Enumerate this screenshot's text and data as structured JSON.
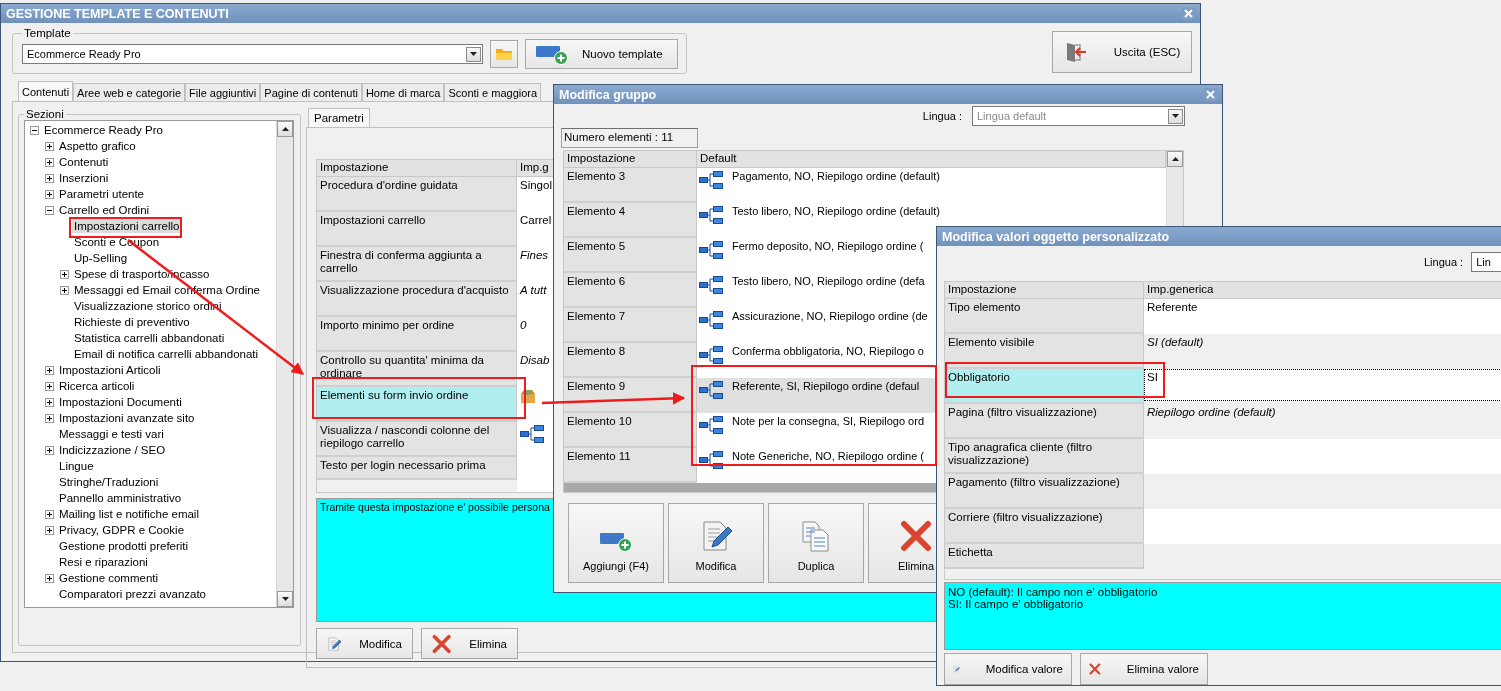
{
  "main_window": {
    "title": "GESTIONE TEMPLATE E CONTENUTI",
    "template": {
      "label": "Template",
      "value": "Ecommerce Ready Pro"
    },
    "template_buttons": [
      {
        "kind": "folder"
      },
      {
        "kind": "add",
        "label": "Nuovo template"
      }
    ],
    "exit_button": {
      "kind": "exit",
      "label": "Uscita (ESC)"
    },
    "tabs": [
      {
        "label": "Contenuti",
        "selected": true
      },
      {
        "label": "Aree web e categorie",
        "selected": false
      },
      {
        "label": "File aggiuntivi",
        "selected": false
      },
      {
        "label": "Pagine di contenuti",
        "selected": false
      },
      {
        "label": "Home di marca",
        "selected": false
      },
      {
        "label": "Sconti e maggiora",
        "selected": false
      }
    ],
    "sections": {
      "label": "Sezioni",
      "tree": {
        "label": "Ecommerce Ready Pro",
        "kind": "group",
        "expanded": true,
        "selected": false,
        "children": [
          {
            "label": "Aspetto grafico",
            "kind": "group",
            "expanded": false,
            "selected": false
          },
          {
            "label": "Contenuti",
            "kind": "group",
            "expanded": false,
            "selected": false
          },
          {
            "label": "Inserzioni",
            "kind": "group",
            "expanded": false,
            "selected": false
          },
          {
            "label": "Parametri utente",
            "kind": "group",
            "expanded": false,
            "selected": false
          },
          {
            "label": "Carrello ed Ordini",
            "kind": "group",
            "expanded": true,
            "selected": false,
            "children": [
              {
                "label": "Impostazioni carrello",
                "kind": "leaf",
                "selected": true
              },
              {
                "label": "Sconti e Coupon",
                "kind": "leaf",
                "selected": false
              },
              {
                "label": "Up-Selling",
                "kind": "leaf",
                "selected": false
              },
              {
                "label": "Spese di trasporto/incasso",
                "kind": "group",
                "expanded": false,
                "selected": false
              },
              {
                "label": "Messaggi ed Email conferma Ordine",
                "kind": "group",
                "expanded": false,
                "selected": false
              },
              {
                "label": "Visualizzazione storico ordini",
                "kind": "leaf",
                "selected": false
              },
              {
                "label": "Richieste di preventivo",
                "kind": "leaf",
                "selected": false
              },
              {
                "label": "Statistica carrelli abbandonati",
                "kind": "leaf",
                "selected": false
              },
              {
                "label": "Email di notifica carrelli abbandonati",
                "kind": "leaf",
                "selected": false
              }
            ]
          },
          {
            "label": "Impostazioni Articoli",
            "kind": "group",
            "expanded": false,
            "selected": false
          },
          {
            "label": "Ricerca articoli",
            "kind": "group",
            "expanded": false,
            "selected": false
          },
          {
            "label": "Impostazioni Documenti",
            "kind": "group",
            "expanded": false,
            "selected": false
          },
          {
            "label": "Impostazioni avanzate sito",
            "kind": "group",
            "expanded": false,
            "selected": false
          },
          {
            "label": "Messaggi e testi vari",
            "kind": "leaf",
            "selected": false
          },
          {
            "label": "Indicizzazione / SEO",
            "kind": "group",
            "expanded": false,
            "selected": false
          },
          {
            "label": "Lingue",
            "kind": "leaf",
            "selected": false
          },
          {
            "label": "Stringhe/Traduzioni",
            "kind": "leaf",
            "selected": false
          },
          {
            "label": "Pannello amministrativo",
            "kind": "leaf",
            "selected": false
          },
          {
            "label": "Mailing list e notifiche email",
            "kind": "group",
            "expanded": false,
            "selected": false
          },
          {
            "label": "Privacy, GDPR e Cookie",
            "kind": "group",
            "expanded": false,
            "selected": false
          },
          {
            "label": "Gestione prodotti preferiti",
            "kind": "leaf",
            "selected": false
          },
          {
            "label": "Resi e riparazioni",
            "kind": "leaf",
            "selected": false
          },
          {
            "label": "Gestione commenti",
            "kind": "group",
            "expanded": false,
            "selected": false
          },
          {
            "label": "Comparatori prezzi avanzato",
            "kind": "leaf",
            "selected": false
          }
        ]
      }
    },
    "parameters": {
      "tab": "Parametri",
      "columns": [
        "Impostazione",
        "Imp.g"
      ],
      "rows": [
        {
          "setting": "Procedura d'ordine guidata",
          "kind": "text",
          "value": "Singol",
          "selected": false
        },
        {
          "setting": "Impostazioni carrello",
          "kind": "text",
          "value": "Carrel",
          "selected": false
        },
        {
          "setting": "Finestra di conferma aggiunta a carrello",
          "kind": "default",
          "value": "Fines",
          "selected": false
        },
        {
          "setting": "Visualizzazione procedura d'acquisto",
          "kind": "default",
          "value": "A tutt",
          "selected": false
        },
        {
          "setting": "Importo minimo per ordine",
          "kind": "default",
          "value": "0",
          "selected": false
        },
        {
          "setting": "Controllo su quantita' minima da ordinare",
          "kind": "default",
          "value": "Disab",
          "selected": false
        },
        {
          "setting": "Elementi su form invio ordine",
          "kind": "package",
          "selected": true
        },
        {
          "setting": "Visualizza / nascondi colonne del riepilogo carrello",
          "kind": "hierarchy",
          "selected": false
        },
        {
          "setting": "Testo per login necessario prima",
          "kind": "empty",
          "selected": false
        }
      ],
      "description": "Tramite questa impostazione e' possibile persona",
      "buttons": [
        {
          "kind": "edit",
          "label": "Modifica"
        },
        {
          "kind": "delete",
          "label": "Elimina"
        }
      ]
    }
  },
  "group_dialog": {
    "title": "Modifica gruppo",
    "language_label": "Lingua :",
    "language": {
      "value": "Lingua default",
      "disabled": true
    },
    "count": "Numero elementi : 11",
    "columns": [
      "Impostazione",
      "Default"
    ],
    "rows": [
      {
        "name": "Elemento 3",
        "value": "Pagamento, NO, Riepilogo ordine (default)",
        "selected": false
      },
      {
        "name": "Elemento 4",
        "value": "Testo libero, NO, Riepilogo ordine (default)",
        "selected": false
      },
      {
        "name": "Elemento 5",
        "value": "Fermo deposito, NO, Riepilogo ordine (",
        "selected": false
      },
      {
        "name": "Elemento 6",
        "value": "Testo libero, NO, Riepilogo ordine (defa",
        "selected": false
      },
      {
        "name": "Elemento 7",
        "value": "Assicurazione, NO, Riepilogo ordine (de",
        "selected": false
      },
      {
        "name": "Elemento 8",
        "value": "Conferma obbligatoria, NO, Riepilogo o",
        "selected": false
      },
      {
        "name": "Elemento 9",
        "value": "Referente, SI, Riepilogo ordine (defaul",
        "selected": true
      },
      {
        "name": "Elemento 10",
        "value": "Note per la consegna, SI, Riepilogo ord",
        "selected": false
      },
      {
        "name": "Elemento 11",
        "value": "Note Generiche, NO, Riepilogo ordine (",
        "selected": false
      }
    ],
    "buttons": [
      {
        "kind": "add",
        "label": "Aggiungi (F4)"
      },
      {
        "kind": "edit",
        "label": "Modifica"
      },
      {
        "kind": "copy",
        "label": "Duplica"
      },
      {
        "kind": "delete",
        "label": "Elimina"
      }
    ]
  },
  "values_dialog": {
    "title": "Modifica valori oggetto personalizzato",
    "language_label": "Lingua :",
    "language": {
      "value": "Lin",
      "disabled": false
    },
    "columns": [
      "Impostazione",
      "Imp.generica"
    ],
    "rows": [
      {
        "setting": "Tipo elemento",
        "kind": "text",
        "value": "Referente",
        "selected": false
      },
      {
        "setting": "Elemento visibile",
        "kind": "default",
        "value": "SI (default)",
        "selected": false
      },
      {
        "setting": "Obbligatorio",
        "kind": "text",
        "value": "SI",
        "selected": true
      },
      {
        "setting": "Pagina (filtro visualizzazione)",
        "kind": "default",
        "value": "Riepilogo ordine (default)",
        "selected": false
      },
      {
        "setting": "Tipo anagrafica cliente (filtro visualizzazione)",
        "kind": "empty",
        "selected": false
      },
      {
        "setting": "Pagamento (filtro visualizzazione)",
        "kind": "empty",
        "selected": false
      },
      {
        "setting": "Corriere (filtro visualizzazione)",
        "kind": "empty",
        "selected": false
      },
      {
        "setting": "Etichetta",
        "kind": "empty",
        "selected": false
      }
    ],
    "description": [
      "NO (default): Il campo non e' obbligatorio",
      "SI: Il campo e' obbligatorio"
    ],
    "buttons": [
      {
        "kind": "edit",
        "label": "Modifica valore"
      },
      {
        "kind": "delete",
        "label": "Elimina valore"
      }
    ]
  }
}
